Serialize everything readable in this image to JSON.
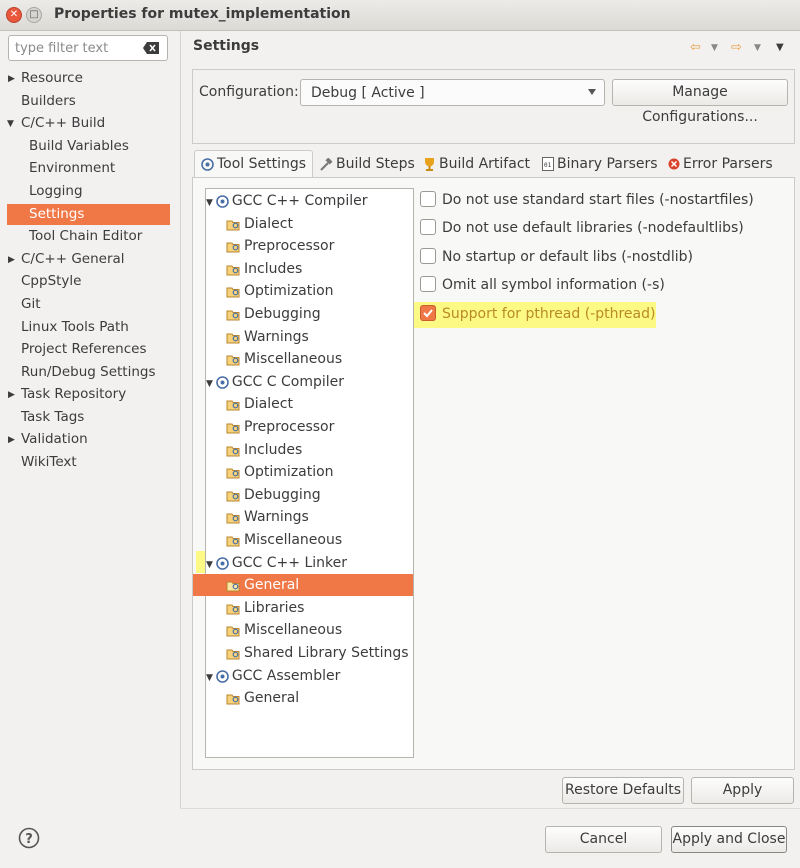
{
  "window": {
    "title": "Properties for mutex_implementation"
  },
  "sidebar": {
    "filter_placeholder": "type filter text",
    "items": [
      {
        "label": "Resource",
        "expandable": true
      },
      {
        "label": "Builders"
      },
      {
        "label": "C/C++ Build",
        "expanded": true
      },
      {
        "label": "Build Variables"
      },
      {
        "label": "Environment"
      },
      {
        "label": "Logging"
      },
      {
        "label": "Settings",
        "selected": true
      },
      {
        "label": "Tool Chain Editor"
      },
      {
        "label": "C/C++ General",
        "expandable": true
      },
      {
        "label": "CppStyle"
      },
      {
        "label": "Git"
      },
      {
        "label": "Linux Tools Path"
      },
      {
        "label": "Project References"
      },
      {
        "label": "Run/Debug Settings"
      },
      {
        "label": "Task Repository",
        "expandable": true
      },
      {
        "label": "Task Tags"
      },
      {
        "label": "Validation",
        "expandable": true
      },
      {
        "label": "WikiText"
      }
    ]
  },
  "main": {
    "header": "Settings",
    "configuration_label": "Configuration:",
    "configuration_value": "Debug  [ Active ]",
    "manage_button": "Manage Configurations...",
    "tabs": [
      {
        "label": "Tool Settings",
        "icon": "tool-settings-icon",
        "active": true
      },
      {
        "label": "Build Steps",
        "icon": "hammer-icon"
      },
      {
        "label": "Build Artifact",
        "icon": "trophy-icon"
      },
      {
        "label": "Binary Parsers",
        "icon": "binary-icon"
      },
      {
        "label": "Error Parsers",
        "icon": "error-icon"
      }
    ],
    "tree": [
      {
        "label": "GCC C++ Compiler",
        "level": 0
      },
      {
        "label": "Dialect",
        "level": 1
      },
      {
        "label": "Preprocessor",
        "level": 1
      },
      {
        "label": "Includes",
        "level": 1
      },
      {
        "label": "Optimization",
        "level": 1
      },
      {
        "label": "Debugging",
        "level": 1
      },
      {
        "label": "Warnings",
        "level": 1
      },
      {
        "label": "Miscellaneous",
        "level": 1
      },
      {
        "label": "GCC C Compiler",
        "level": 0
      },
      {
        "label": "Dialect",
        "level": 1
      },
      {
        "label": "Preprocessor",
        "level": 1
      },
      {
        "label": "Includes",
        "level": 1
      },
      {
        "label": "Optimization",
        "level": 1
      },
      {
        "label": "Debugging",
        "level": 1
      },
      {
        "label": "Warnings",
        "level": 1
      },
      {
        "label": "Miscellaneous",
        "level": 1
      },
      {
        "label": "GCC C++ Linker",
        "level": 0,
        "highlighted": true
      },
      {
        "label": "General",
        "level": 1,
        "selected": true,
        "highlighted": true
      },
      {
        "label": "Libraries",
        "level": 1
      },
      {
        "label": "Miscellaneous",
        "level": 1
      },
      {
        "label": "Shared Library Settings",
        "level": 1
      },
      {
        "label": "GCC Assembler",
        "level": 0
      },
      {
        "label": "General",
        "level": 1
      }
    ],
    "options": [
      {
        "label": "Do not use standard start files (-nostartfiles)",
        "checked": false
      },
      {
        "label": "Do not use default libraries (-nodefaultlibs)",
        "checked": false
      },
      {
        "label": "No startup or default libs (-nostdlib)",
        "checked": false
      },
      {
        "label": "Omit all symbol information (-s)",
        "checked": false
      },
      {
        "label": "Support for pthread (-pthread)",
        "checked": true,
        "highlighted": true
      }
    ],
    "restore_defaults": "Restore Defaults",
    "apply": "Apply"
  },
  "footer": {
    "cancel": "Cancel",
    "apply_and_close": "Apply and Close"
  },
  "colors": {
    "accent": "#f07746",
    "highlight": "#fdfa70"
  }
}
